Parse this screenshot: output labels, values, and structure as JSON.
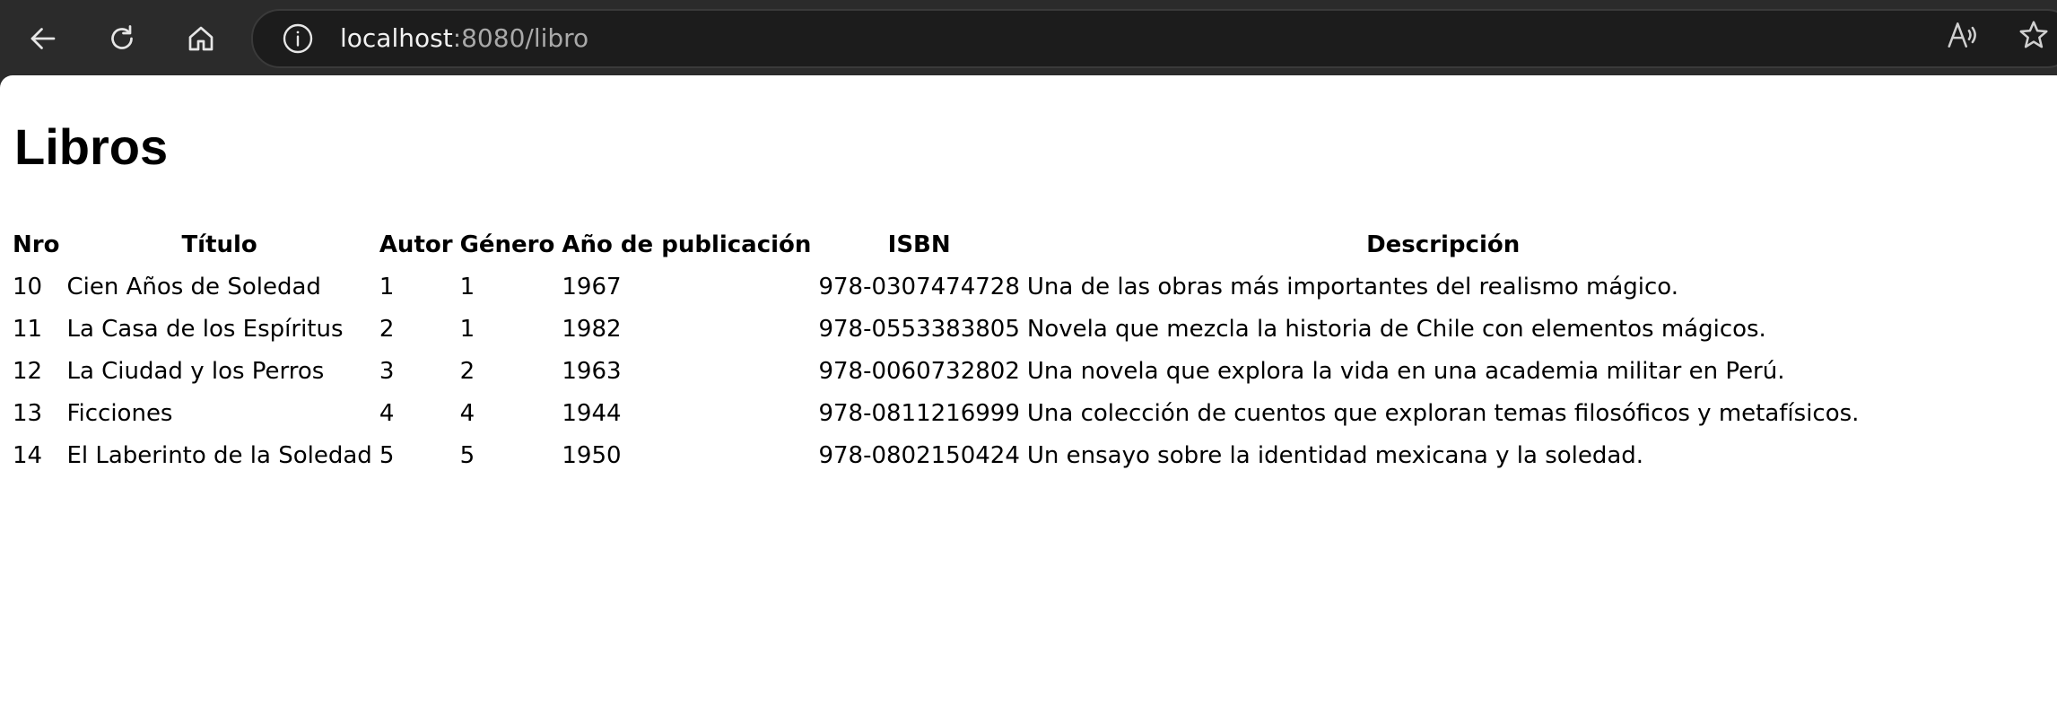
{
  "browser": {
    "url_host": "localhost",
    "url_path": ":8080/libro",
    "icons": [
      "back-arrow-icon",
      "reload-icon",
      "home-icon",
      "info-icon",
      "read-aloud-icon",
      "favorite-star-icon"
    ]
  },
  "page": {
    "title": "Libros"
  },
  "table": {
    "headers": {
      "nro": "Nro",
      "titulo": "Título",
      "autor": "Autor",
      "genero": "Género",
      "anio": "Año de publicación",
      "isbn": "ISBN",
      "descripcion": "Descripción"
    },
    "rows": [
      {
        "nro": "10",
        "titulo": "Cien Años de Soledad",
        "autor": "1",
        "genero": "1",
        "anio": "1967",
        "isbn": "978-0307474728",
        "descripcion": "Una de las obras más importantes del realismo mágico."
      },
      {
        "nro": "11",
        "titulo": "La Casa de los Espíritus",
        "autor": "2",
        "genero": "1",
        "anio": "1982",
        "isbn": "978-0553383805",
        "descripcion": "Novela que mezcla la historia de Chile con elementos mágicos."
      },
      {
        "nro": "12",
        "titulo": "La Ciudad y los Perros",
        "autor": "3",
        "genero": "2",
        "anio": "1963",
        "isbn": "978-0060732802",
        "descripcion": "Una novela que explora la vida en una academia militar en Perú."
      },
      {
        "nro": "13",
        "titulo": "Ficciones",
        "autor": "4",
        "genero": "4",
        "anio": "1944",
        "isbn": "978-0811216999",
        "descripcion": "Una colección de cuentos que exploran temas filosóficos y metafísicos."
      },
      {
        "nro": "14",
        "titulo": "El Laberinto de la Soledad",
        "autor": "5",
        "genero": "5",
        "anio": "1950",
        "isbn": "978-0802150424",
        "descripcion": "Un ensayo sobre la identidad mexicana y la soledad."
      }
    ]
  }
}
